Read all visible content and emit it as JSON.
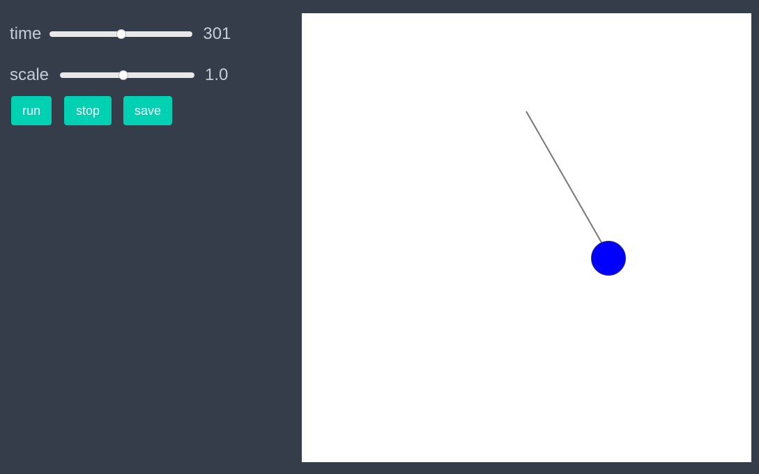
{
  "controls": {
    "time": {
      "label": "time",
      "value": "301",
      "fraction": 0.5
    },
    "scale": {
      "label": "scale",
      "value": "1.0",
      "fraction": 0.47
    }
  },
  "buttons": {
    "run": "run",
    "stop": "stop",
    "save": "save"
  },
  "colors": {
    "background": "#363d4a",
    "button": "#00d1b2",
    "bob": "#0000ff",
    "rod": "#777777",
    "canvas": "#ffffff"
  }
}
